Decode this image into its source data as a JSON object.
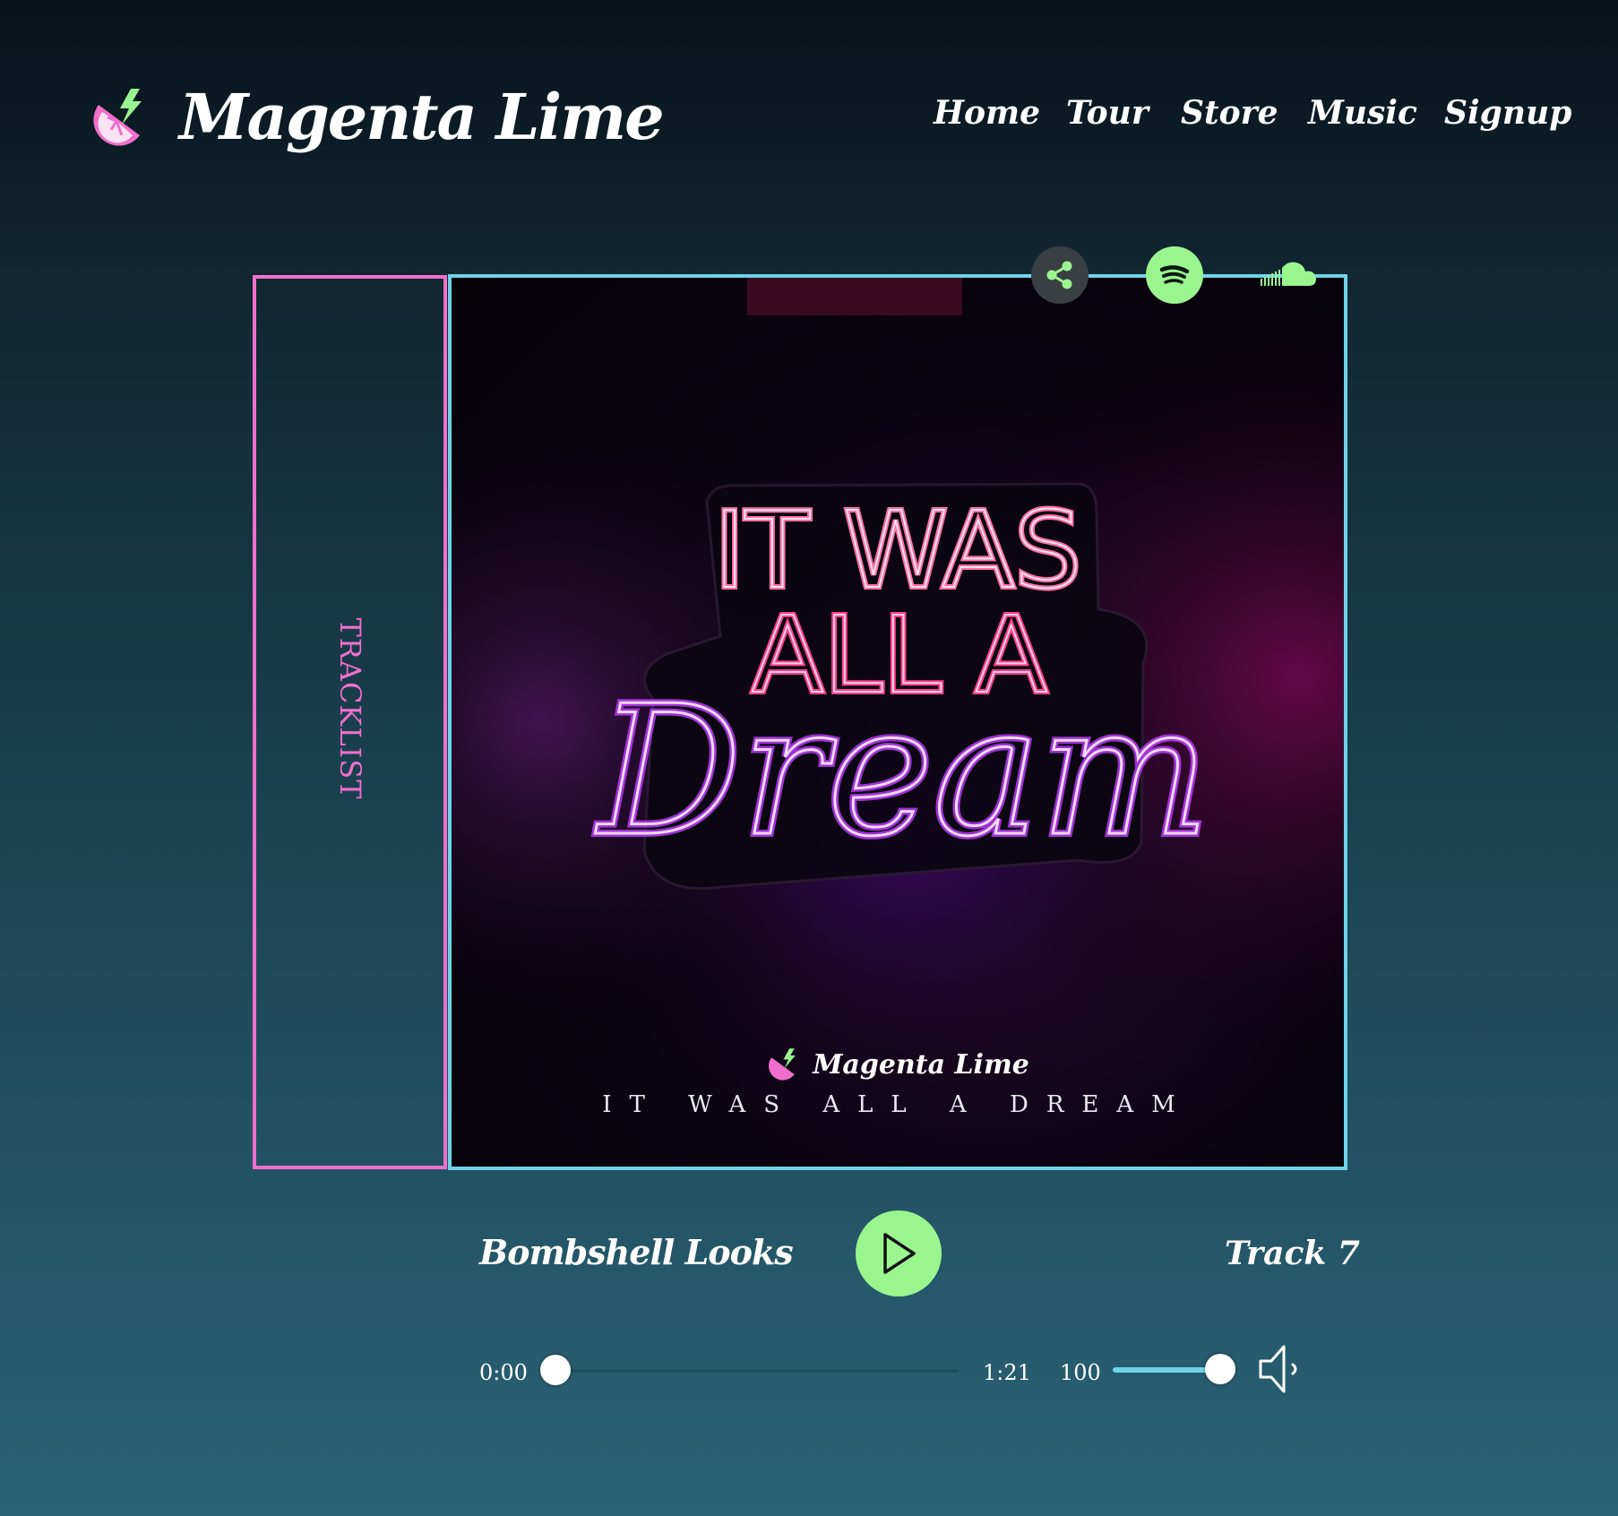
{
  "brand": {
    "name": "Magenta Lime",
    "logo_icon": "lime-slice-lightning-icon"
  },
  "nav": {
    "items": [
      {
        "label": "Home"
      },
      {
        "label": "Tour"
      },
      {
        "label": "Store"
      },
      {
        "label": "Music"
      },
      {
        "label": "Signup"
      }
    ]
  },
  "social": {
    "icons": [
      "share-icon",
      "spotify-icon",
      "soundcloud-icon"
    ]
  },
  "tracklist": {
    "label": "TRACKLIST"
  },
  "album": {
    "art_lines": [
      "IT WAS",
      "ALL A",
      "Dream"
    ],
    "brand": "Magenta Lime",
    "title": "IT WAS ALL A DREAM"
  },
  "player": {
    "track_title": "Bombshell Looks",
    "track_number": "Track 7",
    "current_time": "0:00",
    "total_time": "1:21",
    "progress_fraction": 0,
    "volume": "100",
    "volume_fraction": 1.0
  },
  "colors": {
    "accent_pink": "#f06fcc",
    "accent_cyan": "#6fd3e7",
    "accent_green": "#9af58f"
  }
}
